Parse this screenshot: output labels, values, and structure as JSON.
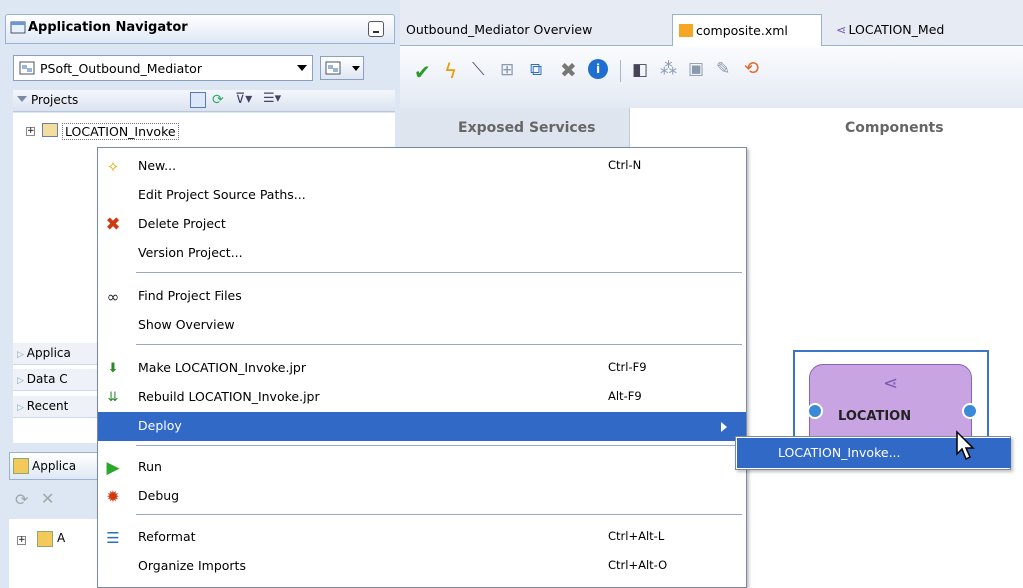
{
  "navigator": {
    "title": "Application Navigator",
    "app_name": "PSoft_Outbound_Mediator",
    "projects_label": "Projects",
    "tree_item": "LOCATION_Invoke",
    "collapsed_sections": [
      "Applica",
      "Data C",
      "Recent"
    ],
    "second_panel_title": "Applica",
    "second_tree_item": "A"
  },
  "tabs": [
    {
      "label": "Outbound_Mediator Overview",
      "icon": "overview-icon"
    },
    {
      "label": "composite.xml",
      "icon": "composite-icon"
    },
    {
      "label": "LOCATION_Med",
      "icon": "mediator-icon"
    }
  ],
  "canvas": {
    "exposed_services": "Exposed Services",
    "components": "Components",
    "component_label": "LOCATION"
  },
  "context_menu": {
    "items": [
      {
        "label": "New...",
        "shortcut": "Ctrl-N",
        "icon": "new-icon"
      },
      {
        "label": "Edit Project Source Paths...",
        "shortcut": "",
        "icon": ""
      },
      {
        "label": "Delete Project",
        "shortcut": "",
        "icon": "delete-icon"
      },
      {
        "label": "Version Project...",
        "shortcut": "",
        "icon": ""
      },
      {
        "label": "Find Project Files",
        "shortcut": "",
        "icon": "binoculars-icon"
      },
      {
        "label": "Show Overview",
        "shortcut": "",
        "icon": ""
      },
      {
        "label": "Make LOCATION_Invoke.jpr",
        "shortcut": "Ctrl-F9",
        "icon": "make-icon"
      },
      {
        "label": "Rebuild LOCATION_Invoke.jpr",
        "shortcut": "Alt-F9",
        "icon": "rebuild-icon"
      },
      {
        "label": "Deploy",
        "shortcut": "",
        "icon": ""
      },
      {
        "label": "Run",
        "shortcut": "",
        "icon": "run-icon"
      },
      {
        "label": "Debug",
        "shortcut": "",
        "icon": "debug-icon"
      },
      {
        "label": "Reformat",
        "shortcut": "Ctrl+Alt-L",
        "icon": "reformat-icon"
      },
      {
        "label": "Organize Imports",
        "shortcut": "Ctrl+Alt-O",
        "icon": ""
      }
    ],
    "submenu_item": "LOCATION_Invoke..."
  },
  "colors": {
    "highlight": "#3169c6",
    "component_fill": "#c9a4e3"
  }
}
